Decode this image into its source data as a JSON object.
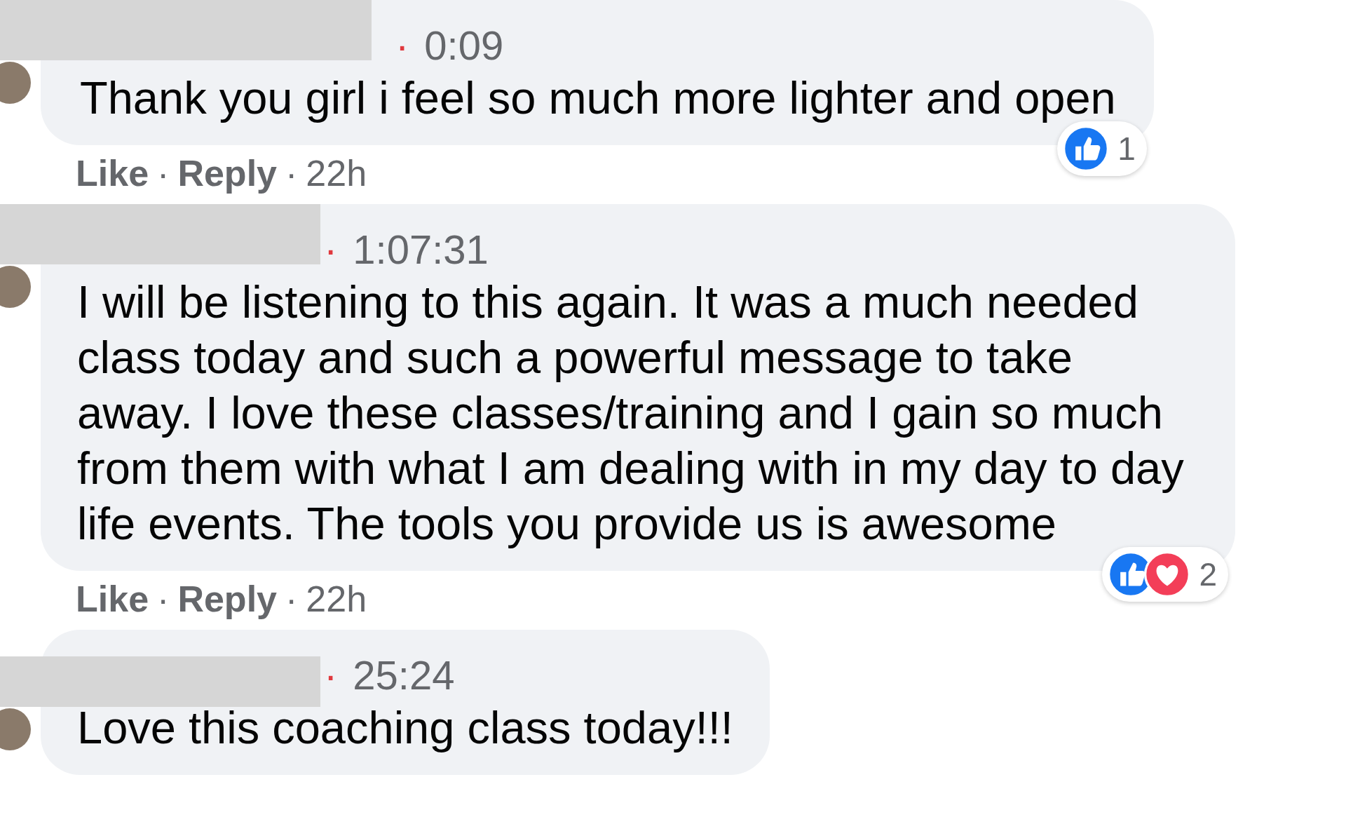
{
  "comments": [
    {
      "dot": "·",
      "time": "0:09",
      "text": "Thank you girl i feel so much more lighter and open",
      "reactions": {
        "icons": [
          {
            "kind": "like"
          }
        ],
        "count": "1"
      },
      "actions": {
        "like": "Like",
        "reply": "Reply",
        "sep": "·",
        "age": "22h"
      }
    },
    {
      "dot": "·",
      "time": "1:07:31",
      "text": "I will be listening to this again. It was a much needed class today and such a powerful message to take away. I love these classes/training and I gain so much from them with what I am dealing with in my day to day life events. The tools you provide us is awesome",
      "reactions": {
        "icons": [
          {
            "kind": "like"
          },
          {
            "kind": "love"
          }
        ],
        "count": "2"
      },
      "actions": {
        "like": "Like",
        "reply": "Reply",
        "sep": "·",
        "age": "22h"
      }
    },
    {
      "dot": "·",
      "time": "25:24",
      "text": "Love this coaching class today!!!"
    }
  ]
}
